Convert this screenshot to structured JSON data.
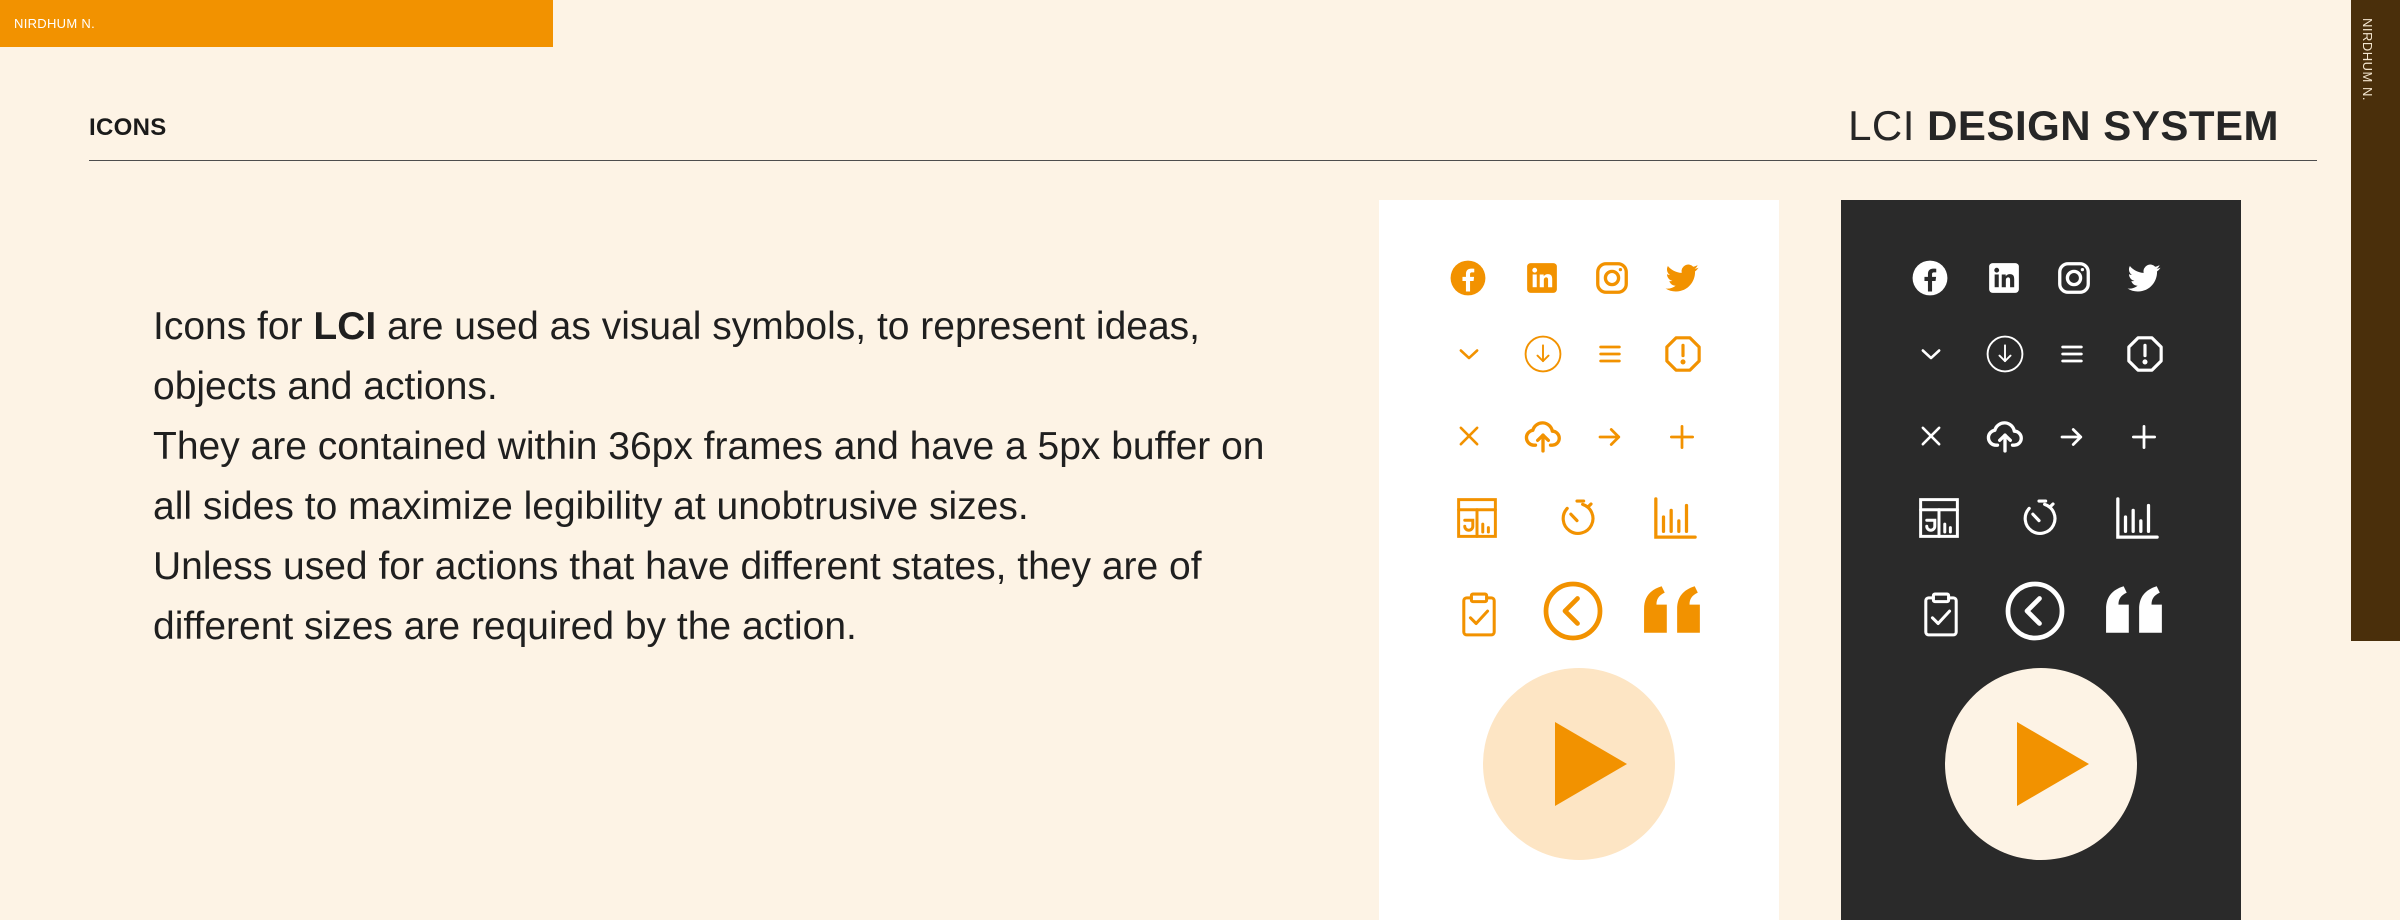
{
  "author_tag": "NIRDHUM N.",
  "side_tag": "NIRDHUM N.",
  "header": {
    "section": "ICONS",
    "brand_light": "LCI ",
    "brand_bold": "DESIGN SYSTEM"
  },
  "description": {
    "line1_pre": "Icons for ",
    "line1_bold": "LCI",
    "line1_post": " are used as visual symbols, to represent ideas, objects and actions.",
    "para2": "They are contained within 36px frames and have a 5px buffer on all sides to maximize legibility at unobtrusive sizes.",
    "para3": "Unless used for actions that have different states, they are of different sizes are required by the action."
  },
  "colors": {
    "background": "#fdf3e5",
    "accent": "#f29200",
    "accent_light": "#fde5c4",
    "dark_panel": "#2a2a2a",
    "side_strip": "#4a2f0b"
  },
  "icon_set": [
    "facebook-icon",
    "linkedin-icon",
    "instagram-icon",
    "twitter-icon",
    "chevron-down-icon",
    "download-circle-icon",
    "menu-icon",
    "alert-octagon-icon",
    "close-icon",
    "upload-cloud-icon",
    "arrow-right-icon",
    "plus-icon",
    "dashboard-icon",
    "timer-icon",
    "bar-chart-icon",
    "clipboard-check-icon",
    "back-circle-icon",
    "quote-icon",
    "play-button-icon"
  ]
}
